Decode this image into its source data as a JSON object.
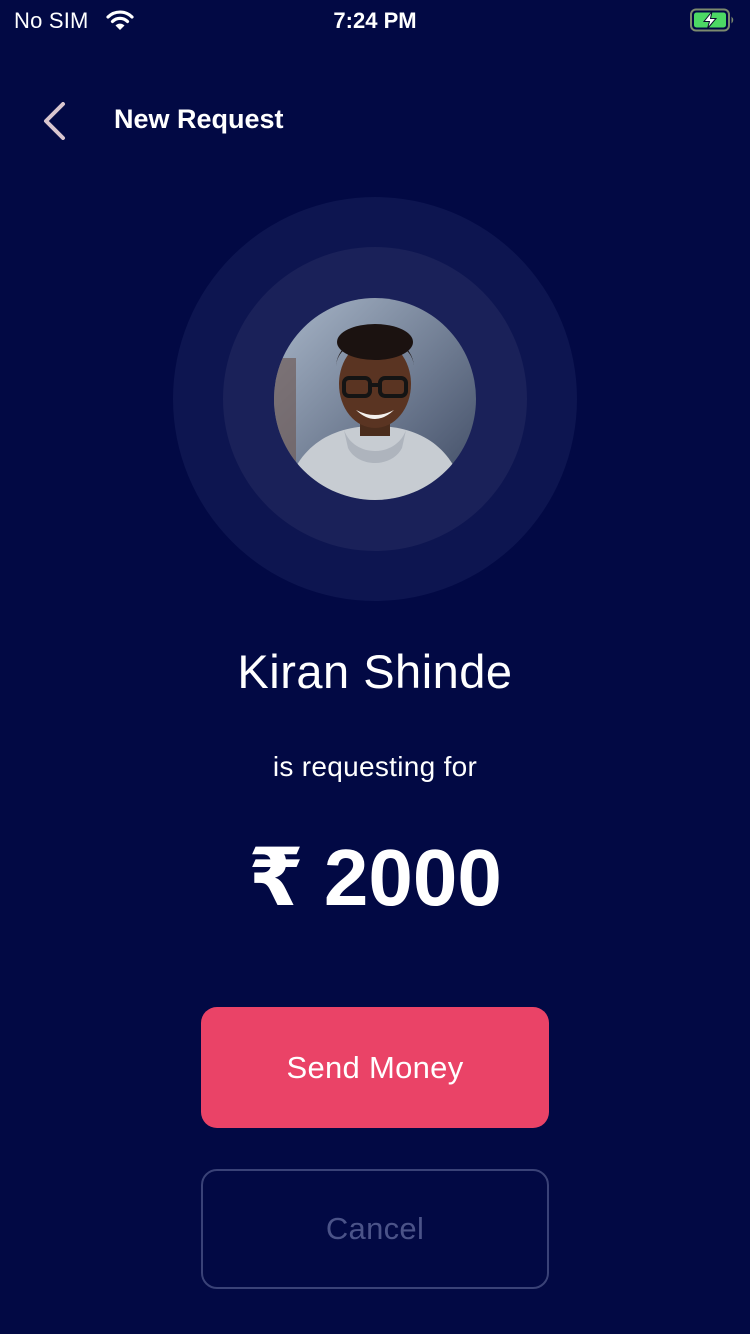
{
  "status_bar": {
    "carrier": "No SIM",
    "time": "7:24 PM",
    "wifi_icon": "wifi-icon",
    "battery_icon": "battery-charging-icon"
  },
  "header": {
    "back_icon": "chevron-left-icon",
    "title": "New Request"
  },
  "requester": {
    "name": "Kiran Shinde",
    "subtitle": "is requesting for"
  },
  "amount": {
    "currency_symbol": "₹",
    "value": "2000"
  },
  "actions": {
    "send_label": "Send Money",
    "cancel_label": "Cancel"
  },
  "colors": {
    "background": "#020944",
    "ring_outer": "#0d1550",
    "ring_inner": "#1a2159",
    "primary": "#ea4367",
    "cancel_text": "#4b5388",
    "battery_green": "#4cd964"
  }
}
